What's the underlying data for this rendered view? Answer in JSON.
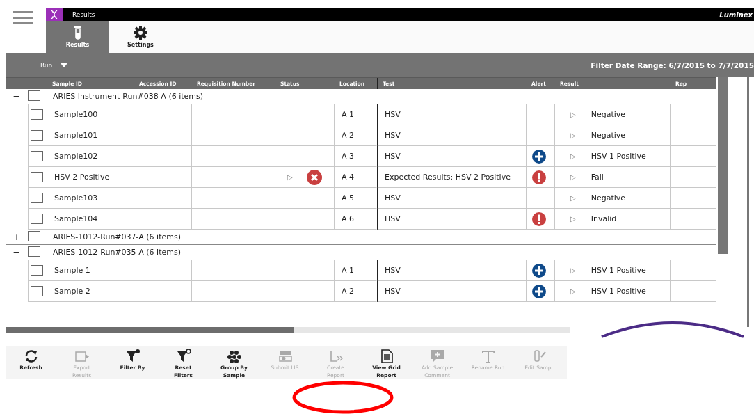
{
  "app": {
    "title": "Results",
    "brand": "Luminex"
  },
  "tabs": [
    {
      "label": "Results",
      "selected": true
    },
    {
      "label": "Settings",
      "selected": false
    }
  ],
  "filter_bar": {
    "run_label": "Run",
    "date_range": "Filter Date Range: 6/7/2015 to 7/7/2015"
  },
  "table": {
    "columns": [
      "Sample ID",
      "Accession ID",
      "Requisition Number",
      "Status",
      "Location",
      "Test",
      "Alert",
      "Result",
      "Rep"
    ],
    "groups": [
      {
        "toggle": "−",
        "expanded": true,
        "checked": false,
        "title": "ARIES Instrument-Run#038-A (6 items)",
        "rows": [
          {
            "checked": false,
            "sample_id": "Sample100",
            "location": "A 1",
            "test": "HSV",
            "result_marker": "▷",
            "result": "Negative"
          },
          {
            "checked": false,
            "sample_id": "Sample101",
            "location": "A 2",
            "test": "HSV",
            "result_marker": "▷",
            "result": "Negative"
          },
          {
            "checked": false,
            "sample_id": "Sample102",
            "location": "A 3",
            "test": "HSV",
            "alert": {
              "kind": "plus"
            },
            "result_marker": "▷",
            "result": "HSV 1 Positive"
          },
          {
            "checked": false,
            "sample_id": "HSV 2 Positive",
            "status_marker": "▷",
            "status_icon": {
              "kind": "error"
            },
            "location": "A 4",
            "test": "Expected Results: HSV 2 Positive",
            "alert": {
              "kind": "exclamation"
            },
            "result_marker": "▷",
            "result": "Fail"
          },
          {
            "checked": false,
            "sample_id": "Sample103",
            "location": "A 5",
            "test": "HSV",
            "result_marker": "▷",
            "result": "Negative"
          },
          {
            "checked": false,
            "sample_id": "Sample104",
            "location": "A 6",
            "test": "HSV",
            "alert": {
              "kind": "exclamation"
            },
            "result_marker": "▷",
            "result": "Invalid"
          }
        ]
      },
      {
        "toggle": "+",
        "expanded": false,
        "checked": false,
        "title": "ARIES-1012-Run#037-A (6 items)"
      },
      {
        "toggle": "−",
        "expanded": true,
        "checked": false,
        "title": "ARIES-1012-Run#035-A (6 items)",
        "rows": [
          {
            "checked": false,
            "sample_id": "Sample 1",
            "location": "A 1",
            "test": "HSV",
            "alert": {
              "kind": "plus"
            },
            "result_marker": "▷",
            "result": "HSV 1 Positive"
          },
          {
            "checked": false,
            "sample_id": "Sample 2",
            "location": "A 2",
            "test": "HSV",
            "alert": {
              "kind": "plus"
            },
            "result_marker": "▷",
            "result": "HSV 1 Positive"
          }
        ]
      }
    ]
  },
  "toolbar": [
    {
      "label": "Refresh",
      "disabled": false
    },
    {
      "label": "Export Results",
      "disabled": true
    },
    {
      "label": "Filter By",
      "disabled": false
    },
    {
      "label": "Reset Filters",
      "disabled": false
    },
    {
      "label": "Group By Sample",
      "disabled": false
    },
    {
      "label": "Submit LIS",
      "disabled": true
    },
    {
      "label": "Create Report",
      "disabled": true
    },
    {
      "label": "View Grid Report",
      "disabled": false
    },
    {
      "label": "Add Sample Comment",
      "disabled": true
    },
    {
      "label": "Rename Run",
      "disabled": true
    },
    {
      "label": "Edit Sampl",
      "disabled": true
    }
  ]
}
